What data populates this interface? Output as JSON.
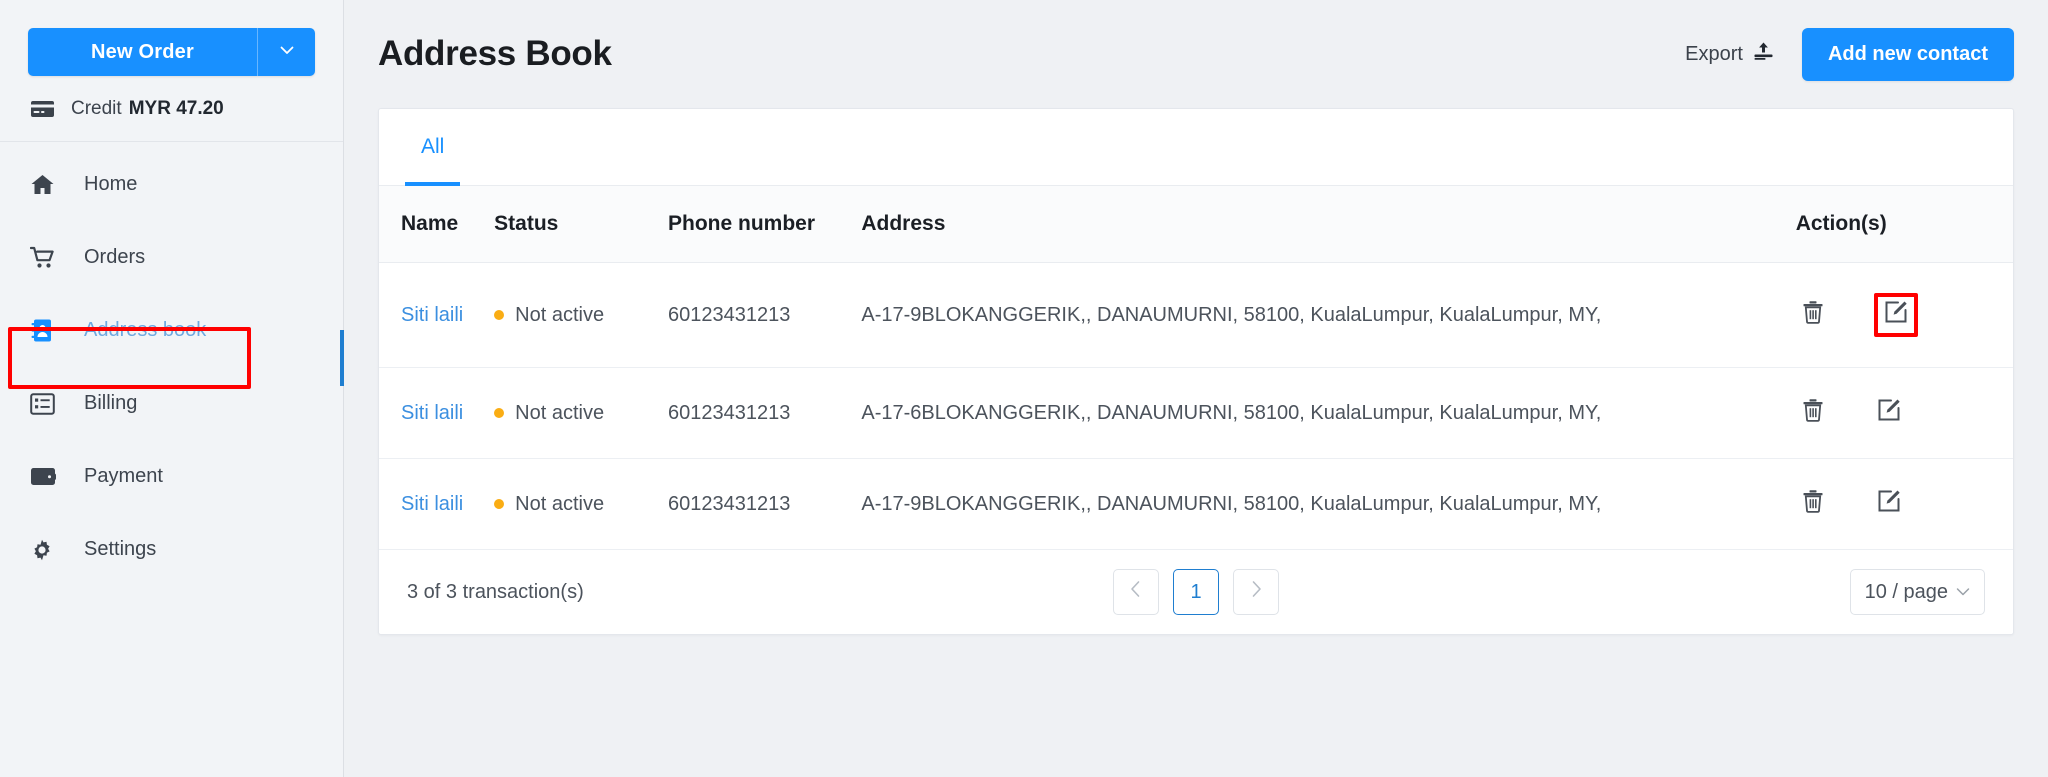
{
  "sidebar": {
    "new_order_label": "New Order",
    "new_order_caret_icon": "chevron-down-icon",
    "credit": {
      "icon": "credit-card-icon",
      "label": "Credit",
      "value": "MYR 47.20"
    },
    "items": [
      {
        "label": "Home",
        "icon": "home-icon",
        "active": false
      },
      {
        "label": "Orders",
        "icon": "shopping-cart-icon",
        "active": false
      },
      {
        "label": "Address book",
        "icon": "address-book-icon",
        "active": true
      },
      {
        "label": "Billing",
        "icon": "list-document-icon",
        "active": false
      },
      {
        "label": "Payment",
        "icon": "wallet-icon",
        "active": false
      },
      {
        "label": "Settings",
        "icon": "gear-icon",
        "active": false
      }
    ]
  },
  "header": {
    "title": "Address Book",
    "export_label": "Export",
    "export_icon": "upload-icon",
    "add_contact_label": "Add new contact"
  },
  "tabs": [
    {
      "label": "All",
      "active": true
    }
  ],
  "table": {
    "columns": [
      "Name",
      "Status",
      "Phone number",
      "Address",
      "Action(s)"
    ],
    "rows": [
      {
        "name": "Siti laili",
        "status": "Not active",
        "status_color": "#faad14",
        "phone": "60123431213",
        "address": "A-17-9BLOKANGGERIK,, DANAUMURNI, 58100, KualaLumpur, KualaLumpur, MY,",
        "delete_icon": "trash-icon",
        "edit_icon": "edit-pencil-icon",
        "edit_highlighted": true
      },
      {
        "name": "Siti laili",
        "status": "Not active",
        "status_color": "#faad14",
        "phone": "60123431213",
        "address": "A-17-6BLOKANGGERIK,, DANAUMURNI, 58100, KualaLumpur, KualaLumpur, MY,",
        "delete_icon": "trash-icon",
        "edit_icon": "edit-pencil-icon",
        "edit_highlighted": false
      },
      {
        "name": "Siti laili",
        "status": "Not active",
        "status_color": "#faad14",
        "phone": "60123431213",
        "address": "A-17-9BLOKANGGERIK,, DANAUMURNI, 58100, KualaLumpur, KualaLumpur, MY,",
        "delete_icon": "trash-icon",
        "edit_icon": "edit-pencil-icon",
        "edit_highlighted": false
      }
    ]
  },
  "footer": {
    "count_text": "3 of 3 transaction(s)",
    "prev_icon": "chevron-left-icon",
    "next_icon": "chevron-right-icon",
    "current_page": "1",
    "page_size_label": "10 / page",
    "page_size_caret_icon": "chevron-down-icon"
  },
  "colors": {
    "accent_blue": "#1890ff",
    "link_blue": "#3b8fe0",
    "status_amber": "#faad14",
    "highlight_red": "#ff0000",
    "page_bg": "#eff1f4",
    "sidebar_bg": "#f2f4f7"
  }
}
